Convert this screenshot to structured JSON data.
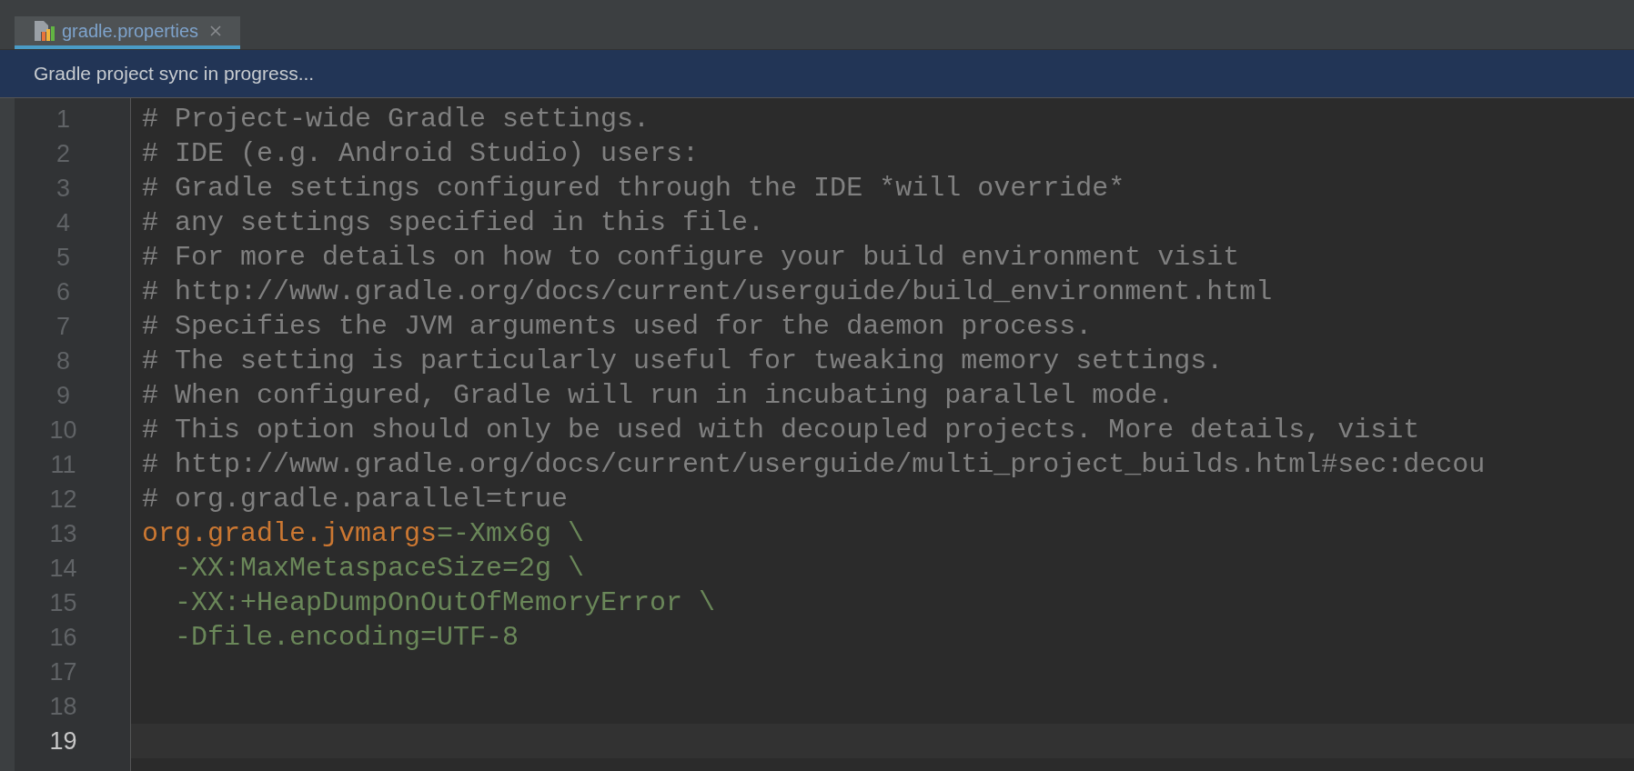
{
  "tabs": [
    {
      "label": "gradle.properties",
      "selected": true
    }
  ],
  "banner": {
    "text": "Gradle project sync in progress..."
  },
  "editor": {
    "lines": [
      {
        "number": "1",
        "current": false,
        "segments": [
          {
            "kind": "comment",
            "text": "# Project-wide Gradle settings."
          }
        ]
      },
      {
        "number": "2",
        "current": false,
        "segments": [
          {
            "kind": "comment",
            "text": "# IDE (e.g. Android Studio) users:"
          }
        ]
      },
      {
        "number": "3",
        "current": false,
        "segments": [
          {
            "kind": "comment",
            "text": "# Gradle settings configured through the IDE *will override*"
          }
        ]
      },
      {
        "number": "4",
        "current": false,
        "segments": [
          {
            "kind": "comment",
            "text": "# any settings specified in this file."
          }
        ]
      },
      {
        "number": "5",
        "current": false,
        "segments": [
          {
            "kind": "comment",
            "text": "# For more details on how to configure your build environment visit"
          }
        ]
      },
      {
        "number": "6",
        "current": false,
        "segments": [
          {
            "kind": "comment",
            "text": "# http://www.gradle.org/docs/current/userguide/build_environment.html"
          }
        ]
      },
      {
        "number": "7",
        "current": false,
        "segments": [
          {
            "kind": "comment",
            "text": "# Specifies the JVM arguments used for the daemon process."
          }
        ]
      },
      {
        "number": "8",
        "current": false,
        "segments": [
          {
            "kind": "comment",
            "text": "# The setting is particularly useful for tweaking memory settings."
          }
        ]
      },
      {
        "number": "9",
        "current": false,
        "segments": [
          {
            "kind": "comment",
            "text": "# When configured, Gradle will run in incubating parallel mode."
          }
        ]
      },
      {
        "number": "10",
        "current": false,
        "segments": [
          {
            "kind": "comment",
            "text": "# This option should only be used with decoupled projects. More details, visit"
          }
        ]
      },
      {
        "number": "11",
        "current": false,
        "segments": [
          {
            "kind": "comment",
            "text": "# http://www.gradle.org/docs/current/userguide/multi_project_builds.html#sec:decou"
          }
        ]
      },
      {
        "number": "12",
        "current": false,
        "segments": [
          {
            "kind": "comment",
            "text": "# org.gradle.parallel=true"
          }
        ]
      },
      {
        "number": "13",
        "current": false,
        "segments": [
          {
            "kind": "key",
            "text": "org.gradle.jvmargs"
          },
          {
            "kind": "value",
            "text": "=-Xmx6g \\"
          }
        ]
      },
      {
        "number": "14",
        "current": false,
        "segments": [
          {
            "kind": "value",
            "text": "  -XX:MaxMetaspaceSize=2g \\"
          }
        ]
      },
      {
        "number": "15",
        "current": false,
        "segments": [
          {
            "kind": "value",
            "text": "  -XX:+HeapDumpOnOutOfMemoryError \\"
          }
        ]
      },
      {
        "number": "16",
        "current": false,
        "segments": [
          {
            "kind": "value",
            "text": "  -Dfile.encoding=UTF-8"
          }
        ]
      },
      {
        "number": "17",
        "current": false
      },
      {
        "number": "18",
        "current": false
      },
      {
        "number": "19",
        "current": true
      }
    ]
  }
}
